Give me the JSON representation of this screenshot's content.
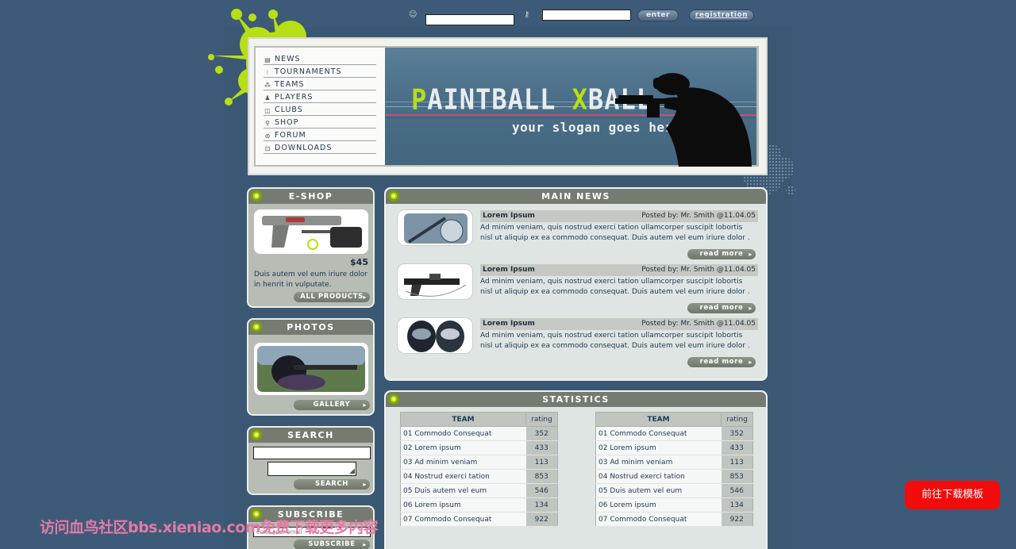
{
  "menu": [
    {
      "icon": "news-icon",
      "glyph": "▤",
      "label": "NEWS"
    },
    {
      "icon": "tournaments-icon",
      "glyph": "⁝",
      "label": "TOURNAMENTS"
    },
    {
      "icon": "teams-icon",
      "glyph": "⁂",
      "label": "TEAMS"
    },
    {
      "icon": "players-icon",
      "glyph": "♟",
      "label": "PLAYERS"
    },
    {
      "icon": "clubs-icon",
      "glyph": "◫",
      "label": "CLUBS"
    },
    {
      "icon": "shop-icon",
      "glyph": "⚲",
      "label": "SHOP"
    },
    {
      "icon": "forum-icon",
      "glyph": "⊚",
      "label": "FORUM"
    },
    {
      "icon": "downloads-icon",
      "glyph": "⊡",
      "label": "DOWNLOADS"
    }
  ],
  "login": {
    "enter_label": "enter",
    "registration_label": "registration",
    "username_value": "",
    "password_value": ""
  },
  "banner": {
    "logo_accent_1": "P",
    "logo_part_1": "AINTBALL ",
    "logo_accent_2": "X",
    "logo_part_2": "BALL",
    "slogan": "your slogan goes here"
  },
  "eshop": {
    "title": "E-SHOP",
    "price": "$45",
    "description": "Duis autem vel eum iriure dolor in henrit in vulputate.",
    "button": "ALL PRODUCTS"
  },
  "photos": {
    "title": "PHOTOS",
    "button": "GALLERY"
  },
  "search": {
    "title": "SEARCH",
    "button": "SEARCH"
  },
  "subscribe": {
    "title": "SUBSCRIBE",
    "input_value": "enter your email",
    "button": "SUBSCRIBE"
  },
  "main_news": {
    "title": "MAIN NEWS",
    "items": [
      {
        "headline": "Lorem Ipsum",
        "meta": "Posted by: Mr. Smith @11.04.05",
        "body": "Ad minim veniam, quis nostrud exerci tation ullamcorper suscipit lobortis nisl ut aliquip ex ea commodo consequat. Duis autem vel eum iriure dolor .",
        "read_more": "read more"
      },
      {
        "headline": "Lorem Ipsum",
        "meta": "Posted by: Mr. Smith @11.04.05",
        "body": "Ad minim veniam, quis nostrud exerci tation ullamcorper suscipit lobortis nisl ut aliquip ex ea commodo consequat. Duis autem vel eum iriure dolor .",
        "read_more": "read more"
      },
      {
        "headline": "Lorem Ipsum",
        "meta": "Posted by: Mr. Smith @11.04.05",
        "body": "Ad minim veniam, quis nostrud exerci tation ullamcorper suscipit lobortis nisl ut aliquip ex ea commodo consequat. Duis autem vel eum iriure dolor .",
        "read_more": "read more"
      }
    ]
  },
  "statistics": {
    "title": "STATISTICS",
    "tables": [
      {
        "headers": [
          "TEAM",
          "rating"
        ],
        "rows": [
          [
            "01 Commodo Consequat",
            "352"
          ],
          [
            "02 Lorem ipsum",
            "433"
          ],
          [
            "03 Ad minim veniam",
            "113"
          ],
          [
            "04 Nostrud exerci tation",
            "853"
          ],
          [
            "05 Duis autem vel eum",
            "546"
          ],
          [
            "06 Lorem ipsum",
            "134"
          ],
          [
            "07 Commodo Consequat",
            "922"
          ]
        ]
      },
      {
        "headers": [
          "TEAM",
          "rating"
        ],
        "rows": [
          [
            "01 Commodo Consequat",
            "352"
          ],
          [
            "02 Lorem ipsum",
            "433"
          ],
          [
            "03 Ad minim veniam",
            "113"
          ],
          [
            "04 Nostrud exerci tation",
            "853"
          ],
          [
            "05 Duis autem vel eum",
            "546"
          ],
          [
            "06 Lorem ipsum",
            "134"
          ],
          [
            "07 Commodo Consequat",
            "922"
          ]
        ]
      }
    ]
  },
  "download_button": "前往下载模板",
  "watermark": "访问血鸟社区bbs.xieniao.com免费下载更多内容",
  "colors": {
    "page_bg": "#3d5b78",
    "accent_green": "#b7df15",
    "panel_header": "#757b70",
    "download_red": "#f10b0b"
  }
}
